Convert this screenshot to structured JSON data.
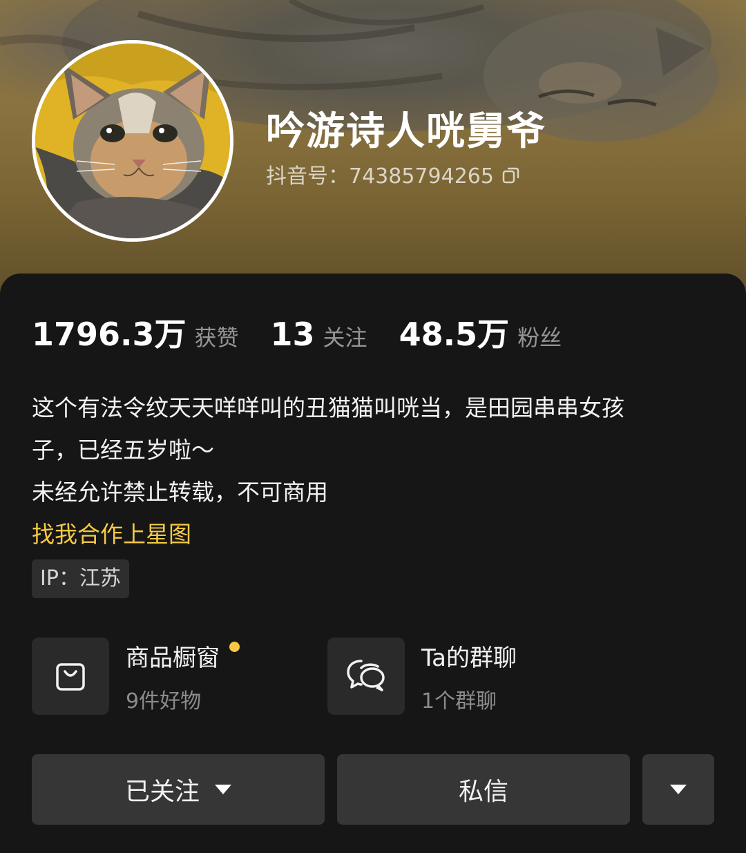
{
  "profile": {
    "nickname": "吟游诗人咣舅爷",
    "douyin_id": "抖音号：74385794265"
  },
  "stats": [
    {
      "value": "1796.3万",
      "label": "获赞"
    },
    {
      "value": "13",
      "label": "关注"
    },
    {
      "value": "48.5万",
      "label": "粉丝"
    }
  ],
  "bio": {
    "line1": "这个有法令纹天天咩咩叫的丑猫猫叫咣当，是田园串串女孩",
    "line2": "子，已经五岁啦～",
    "line3": "未经允许禁止转载，不可商用",
    "link": "找我合作上星图"
  },
  "ip_location": "IP：江苏",
  "features": {
    "shop": {
      "title": "商品橱窗",
      "subtitle": "9件好物"
    },
    "group_chat": {
      "title": "Ta的群聊",
      "subtitle": "1个群聊"
    }
  },
  "actions": {
    "follow_label": "已关注",
    "message_label": "私信"
  },
  "colors": {
    "accent_yellow": "#f6c945",
    "background": "#161616",
    "button": "#363636"
  },
  "icons": [
    "copy-icon",
    "shopping-bag-icon",
    "chat-bubbles-icon",
    "dropdown-triangle-icon"
  ]
}
